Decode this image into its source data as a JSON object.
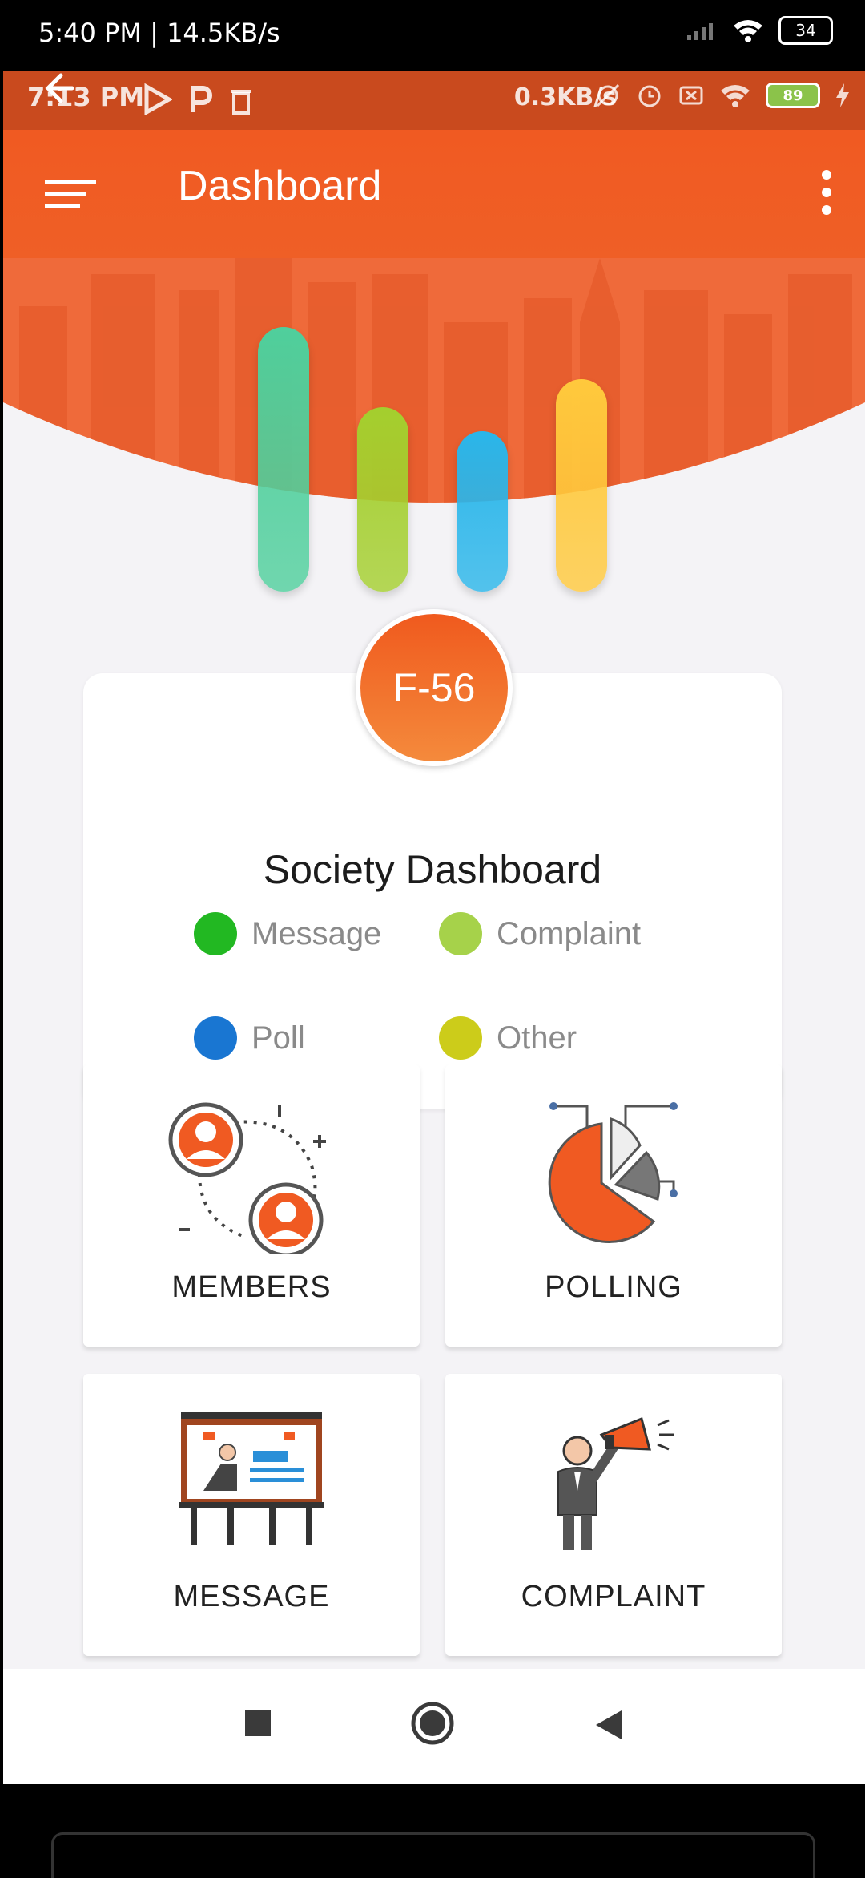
{
  "outer_status": {
    "time": "5:40 PM | 14.5KB/s",
    "battery": "34"
  },
  "inner_status": {
    "time": "7:13 PM",
    "net_speed": "0.3KB/s",
    "battery": "89"
  },
  "appbar": {
    "title": "Dashboard"
  },
  "chart_data": {
    "type": "bar",
    "categories": [
      "",
      "",
      "",
      ""
    ],
    "values": [
      330,
      230,
      200,
      265
    ],
    "colors": [
      "#4fcf9c",
      "#a4cf2e",
      "#2ab6ea",
      "#ffc93c"
    ]
  },
  "card": {
    "flat_number": "F-56",
    "title": "Society Dashboard",
    "legend": [
      {
        "label": "Message",
        "color": "#22b822"
      },
      {
        "label": "Complaint",
        "color": "#a6d24a"
      },
      {
        "label": "Poll",
        "color": "#1976d2"
      },
      {
        "label": "Other",
        "color": "#cccc1a"
      }
    ]
  },
  "tiles": [
    {
      "label": "MEMBERS",
      "icon": "members-icon"
    },
    {
      "label": "POLLING",
      "icon": "pie-chart-icon"
    },
    {
      "label": "MESSAGE",
      "icon": "notice-board-icon"
    },
    {
      "label": "COMPLAINT",
      "icon": "megaphone-icon"
    }
  ],
  "colors": {
    "accent": "#f05a22",
    "background": "#f4f3f6"
  }
}
